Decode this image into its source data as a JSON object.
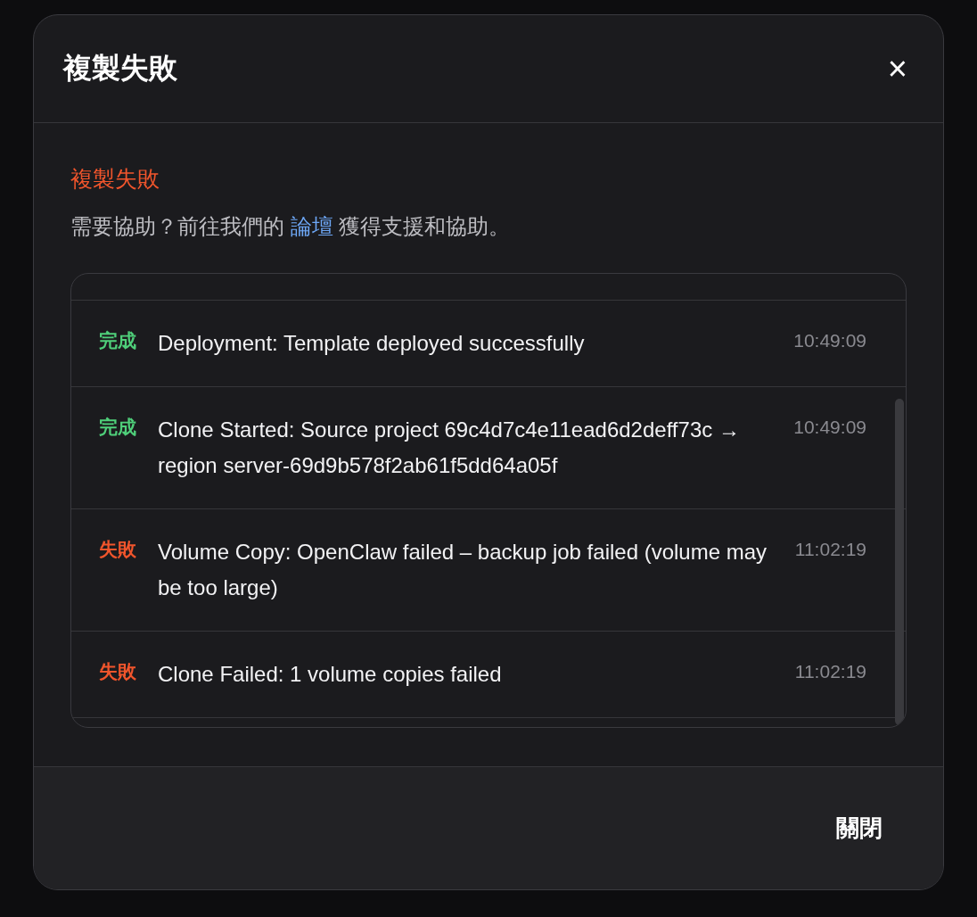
{
  "dialog": {
    "title": "複製失敗",
    "close_icon": "×"
  },
  "error": {
    "title": "複製失敗",
    "help": {
      "before": "需要協助？前往我們的 ",
      "link": "論壇",
      "after": " 獲得支援和協助。"
    }
  },
  "log": [
    {
      "kind": "done",
      "status": "完成",
      "message": "Deployment: Template deployed successfully",
      "time": "10:49:09"
    },
    {
      "kind": "done",
      "status": "完成",
      "message": "Clone Started: Source project 69c4d7c4e11ead6d2deff73c → region server-69d9b578f2ab61f5dd64a05f",
      "time": "10:49:09"
    },
    {
      "kind": "failed",
      "status": "失敗",
      "message": "Volume Copy: OpenClaw failed – backup job failed (volume may be too large)",
      "time": "11:02:19"
    },
    {
      "kind": "failed",
      "status": "失敗",
      "message": "Clone Failed: 1 volume copies failed",
      "time": "11:02:19"
    }
  ],
  "buttons": [
    "關閉"
  ]
}
